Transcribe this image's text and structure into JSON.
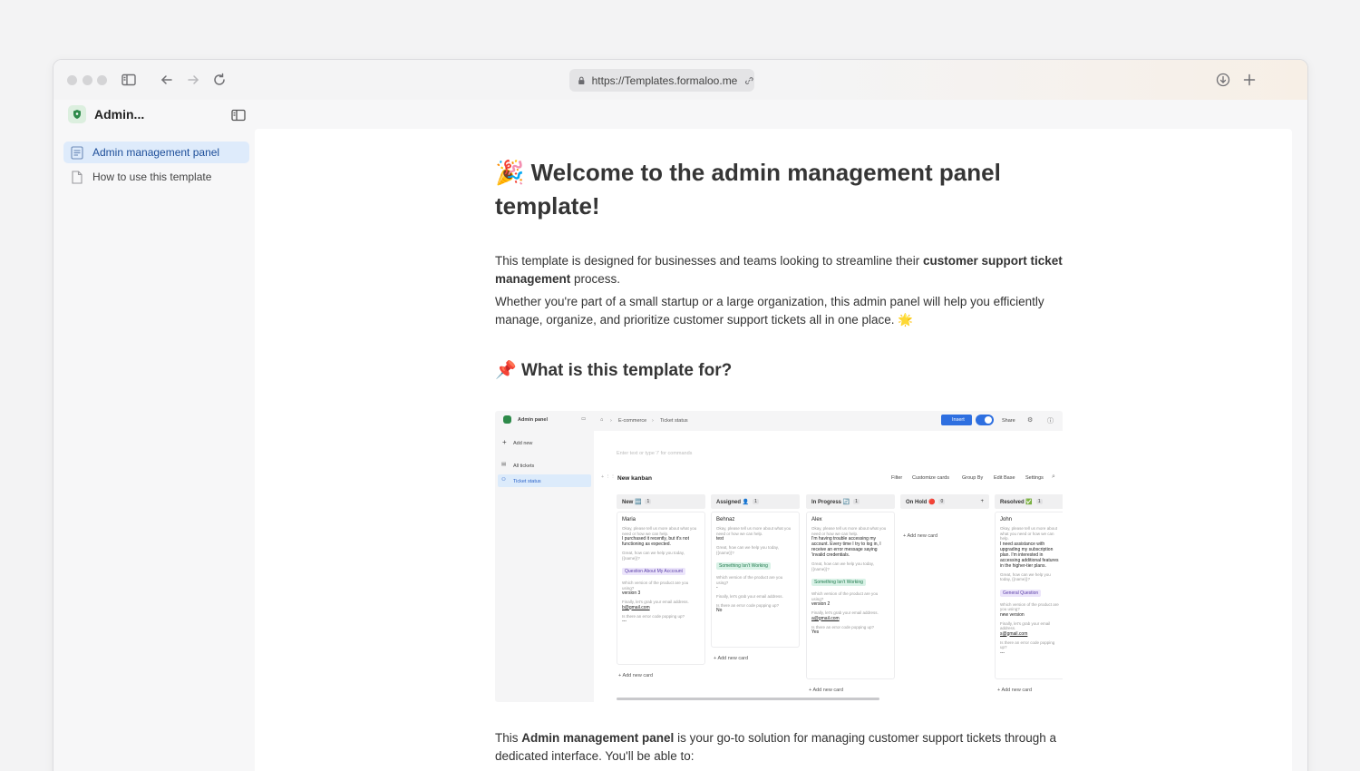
{
  "browser": {
    "url": "https://Templates.formaloo.me"
  },
  "sidebar": {
    "title": "Admin...",
    "items": [
      {
        "label": "Admin management panel",
        "active": true
      },
      {
        "label": "How to use this template",
        "active": false
      }
    ]
  },
  "article": {
    "title_emoji": "🎉",
    "title_line1": "Welcome to the admin management panel",
    "title_line2": "template!",
    "intro_p1_a": "This template is designed for businesses and teams looking to streamline their ",
    "intro_p1_bold": "customer support ticket management",
    "intro_p1_b": " process.",
    "intro_p2": "Whether you're part of a small startup or a large organization, this admin panel will help you efficiently manage, organize, and prioritize customer support tickets all in one place. 🌟",
    "section_emoji": "📌",
    "section_title": "What is this template for?",
    "outro_a": "This ",
    "outro_bold": "Admin management panel",
    "outro_b": " is your go-to solution for managing customer support tickets through a dedicated interface. You'll be able to:"
  },
  "screenshot": {
    "app_name": "Admin panel",
    "breadcrumb_home": "E-commerce",
    "breadcrumb_page": "Ticket status",
    "insert_label": "Insert",
    "share_label": "Share",
    "add_new": "Add new",
    "nav_all": "All tickets",
    "nav_status": "Ticket status",
    "editor_placeholder": "Enter text or type '/' for commands",
    "kanban_title": "New kanban",
    "toolbar": [
      "Filter",
      "Customize cards",
      "Group By",
      "Edit Base",
      "Settings"
    ],
    "add_card": "Add new card",
    "columns": [
      {
        "name": "New 🆕",
        "count": "1"
      },
      {
        "name": "Assigned 👤",
        "count": "1"
      },
      {
        "name": "In Progress 🔄",
        "count": "1"
      },
      {
        "name": "On Hold 🔴",
        "count": "0"
      },
      {
        "name": "Resolved ✅",
        "count": "1"
      }
    ],
    "cards": [
      {
        "name": "Maria",
        "q1": "Okay, please tell us more about what you need or how we can help.",
        "a1": "I purchased it recently, but it's not functioning as expected.",
        "q2": "Great, how can we help you today, {{name}}?",
        "tag": "Question About My Acccount",
        "q3": "Which version of the product are you using?",
        "a3": "version 3",
        "q4": "Finally, let's grab your email address.",
        "a4": "b@gmail.com",
        "q5": "Is there an error code popping up?",
        "a5": "---"
      },
      {
        "name": "Behnaz",
        "q1": "Okay, please tell us more about what you need or how we can help.",
        "a1": "test",
        "q2": "Great, how can we help you today, {{name}}?",
        "tag": "Something Isn't Working",
        "q3": "Which version of the product are you using?",
        "a3": "-",
        "q4": "Finally, let's grab your email address.",
        "q5": "Is there an error code popping up?",
        "a5": "No"
      },
      {
        "name": "Alex",
        "q1": "Okay, please tell us more about what you need or how we can help.",
        "a1": "I'm having trouble accessing my account. Every time I try to log in, I receive an error message saying 'invalid credentials.",
        "q2": "Great, how can we help you today, {{name}}?",
        "tag": "Something Isn't Working",
        "q3": "Which version of the product are you using?",
        "a3": "version 2",
        "q4": "Finally, let's grab your email address.",
        "a4": "a@gmail.com",
        "q5": "Is there an error code popping up?",
        "a5": "Yes"
      },
      {
        "name": "John",
        "q1": "Okay, please tell us more about what you need or how we can help.",
        "a1": "I need assistance with upgrading my subscription plan. I'm interested in accessing additional features in the higher-tier plans.",
        "q2": "Great, how can we help you today, {{name}}?",
        "tag": "General Question",
        "q3": "Which version of the product are you using?",
        "a3": "new version",
        "q4": "Finally, let's grab your email address.",
        "a4": "s@gmail.com",
        "q5": "Is there an error code popping up?",
        "a5": "---"
      }
    ]
  }
}
